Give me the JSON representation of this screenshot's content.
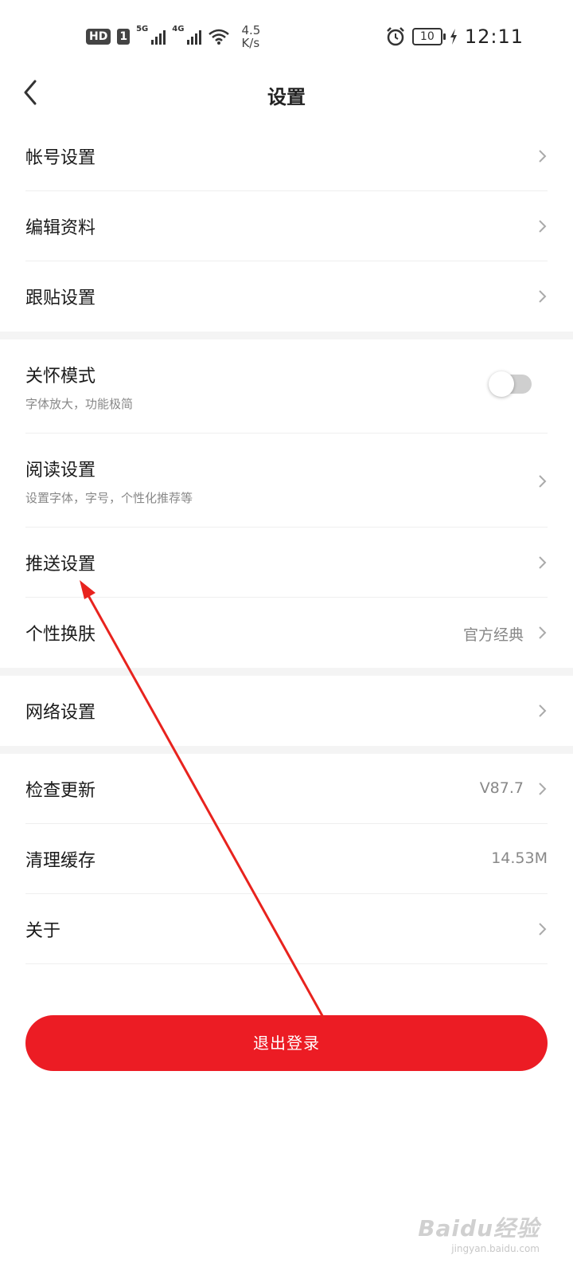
{
  "status_bar": {
    "hd": "HD",
    "sim": "1",
    "net1": "5G",
    "net2": "4G",
    "speed_value": "4.5",
    "speed_unit": "K/s",
    "battery": "10",
    "time": "12:11"
  },
  "nav": {
    "title": "设置"
  },
  "group1": [
    {
      "title": "帐号设置"
    },
    {
      "title": "编辑资料"
    },
    {
      "title": "跟贴设置"
    }
  ],
  "group2": {
    "care_mode": {
      "title": "关怀模式",
      "subtitle": "字体放大，功能极简",
      "enabled": false
    },
    "reading": {
      "title": "阅读设置",
      "subtitle": "设置字体，字号，个性化推荐等"
    },
    "push": {
      "title": "推送设置"
    },
    "skin": {
      "title": "个性换肤",
      "value": "官方经典"
    }
  },
  "group3": {
    "network": {
      "title": "网络设置"
    }
  },
  "group4": {
    "update": {
      "title": "检查更新",
      "value": "V87.7"
    },
    "cache": {
      "title": "清理缓存",
      "value": "14.53M"
    },
    "about": {
      "title": "关于"
    }
  },
  "logout": {
    "label": "退出登录"
  },
  "annotation": {
    "color": "#e8231e"
  },
  "watermark": {
    "logo": "Baidu经验",
    "url": "jingyan.baidu.com"
  },
  "colors": {
    "accent": "#ec1c24",
    "divider_band": "#f4f4f4"
  }
}
